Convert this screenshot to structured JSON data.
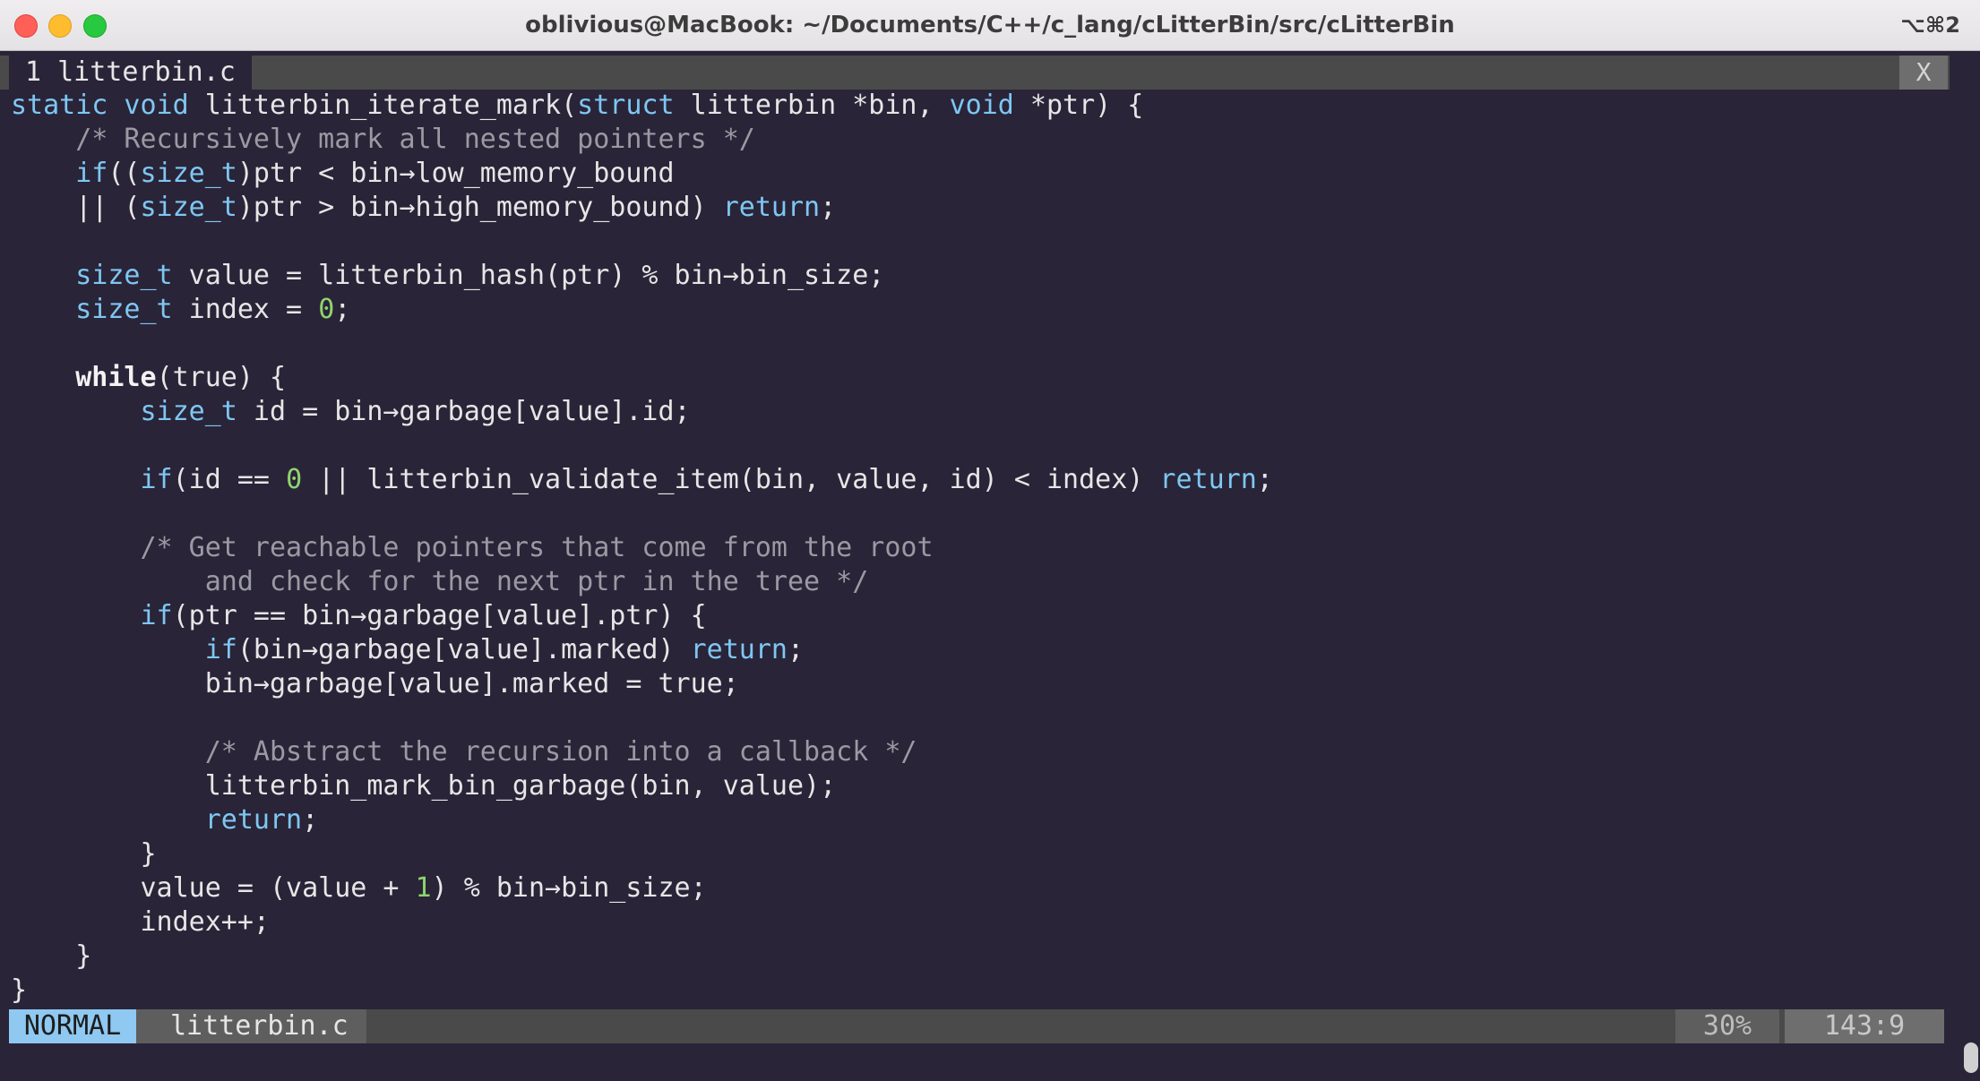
{
  "window": {
    "title": "oblivious@MacBook: ~/Documents/C++/c_lang/cLitterBin/src/cLitterBin",
    "shortcut": "⌥⌘2"
  },
  "tabline": {
    "active_tab": "1 litterbin.c",
    "close_label": "X"
  },
  "code": {
    "lines": [
      [
        [
          "static void ",
          "kw"
        ],
        [
          "litterbin_iterate_mark(",
          ""
        ],
        [
          "struct",
          "kw"
        ],
        [
          " litterbin *bin, ",
          ""
        ],
        [
          "void",
          "kw"
        ],
        [
          " *ptr) {",
          ""
        ]
      ],
      [
        [
          "    /* Recursively mark all nested pointers */",
          "cm"
        ]
      ],
      [
        [
          "    ",
          ""
        ],
        [
          "if",
          "kw"
        ],
        [
          "((",
          ""
        ],
        [
          "size_t",
          "kw"
        ],
        [
          ")ptr < bin→low_memory_bound",
          ""
        ]
      ],
      [
        [
          "    || (",
          ""
        ],
        [
          "size_t",
          "kw"
        ],
        [
          ")ptr > bin→high_memory_bound) ",
          ""
        ],
        [
          "return",
          "kw"
        ],
        [
          ";",
          ""
        ]
      ],
      [],
      [
        [
          "    ",
          ""
        ],
        [
          "size_t",
          "kw"
        ],
        [
          " value = litterbin_hash(ptr) % bin→bin_size;",
          ""
        ]
      ],
      [
        [
          "    ",
          ""
        ],
        [
          "size_t",
          "kw"
        ],
        [
          " index = ",
          ""
        ],
        [
          "0",
          "num"
        ],
        [
          ";",
          ""
        ]
      ],
      [],
      [
        [
          "    ",
          ""
        ],
        [
          "while",
          "kwb"
        ],
        [
          "(true) {",
          ""
        ]
      ],
      [
        [
          "        ",
          ""
        ],
        [
          "size_t",
          "kw"
        ],
        [
          " id = bin→garbage[value].id;",
          ""
        ]
      ],
      [],
      [
        [
          "        ",
          ""
        ],
        [
          "if",
          "kw"
        ],
        [
          "(id == ",
          ""
        ],
        [
          "0",
          "num"
        ],
        [
          " || litterbin_validate_item(bin, value, id) < index) ",
          ""
        ],
        [
          "return",
          "kw"
        ],
        [
          ";",
          ""
        ]
      ],
      [],
      [
        [
          "        /* Get reachable pointers that come from the root",
          "cm"
        ]
      ],
      [
        [
          "            and check for the next ptr in the tree */",
          "cm"
        ]
      ],
      [
        [
          "        ",
          ""
        ],
        [
          "if",
          "kw"
        ],
        [
          "(ptr == bin→garbage[value].ptr) {",
          ""
        ]
      ],
      [
        [
          "            ",
          ""
        ],
        [
          "if",
          "kw"
        ],
        [
          "(bin→garbage[value].marked) ",
          ""
        ],
        [
          "return",
          "kw"
        ],
        [
          ";",
          ""
        ]
      ],
      [
        [
          "            bin→garbage[value].marked = true;",
          ""
        ]
      ],
      [],
      [
        [
          "            /* Abstract the recursion into a callback */",
          "cm"
        ]
      ],
      [
        [
          "            litterbin_mark_bin_garbage(bin, value);",
          ""
        ]
      ],
      [
        [
          "            ",
          ""
        ],
        [
          "return",
          "kw"
        ],
        [
          ";",
          ""
        ]
      ],
      [
        [
          "        }",
          ""
        ]
      ],
      [
        [
          "        value = (value + ",
          ""
        ],
        [
          "1",
          "num"
        ],
        [
          ") % bin→bin_size;",
          ""
        ]
      ],
      [
        [
          "        index++;",
          ""
        ]
      ],
      [
        [
          "    }",
          ""
        ]
      ],
      [
        [
          "}",
          ""
        ]
      ]
    ]
  },
  "statusline": {
    "mode": "NORMAL",
    "filename": "litterbin.c",
    "percent": "30%",
    "position": "143:9"
  },
  "colors": {
    "background": "#2a2438",
    "keyword": "#7ec7f2",
    "comment": "#9a9aa3",
    "number": "#8fd46d",
    "mode_badge": "#8fc8f0"
  }
}
